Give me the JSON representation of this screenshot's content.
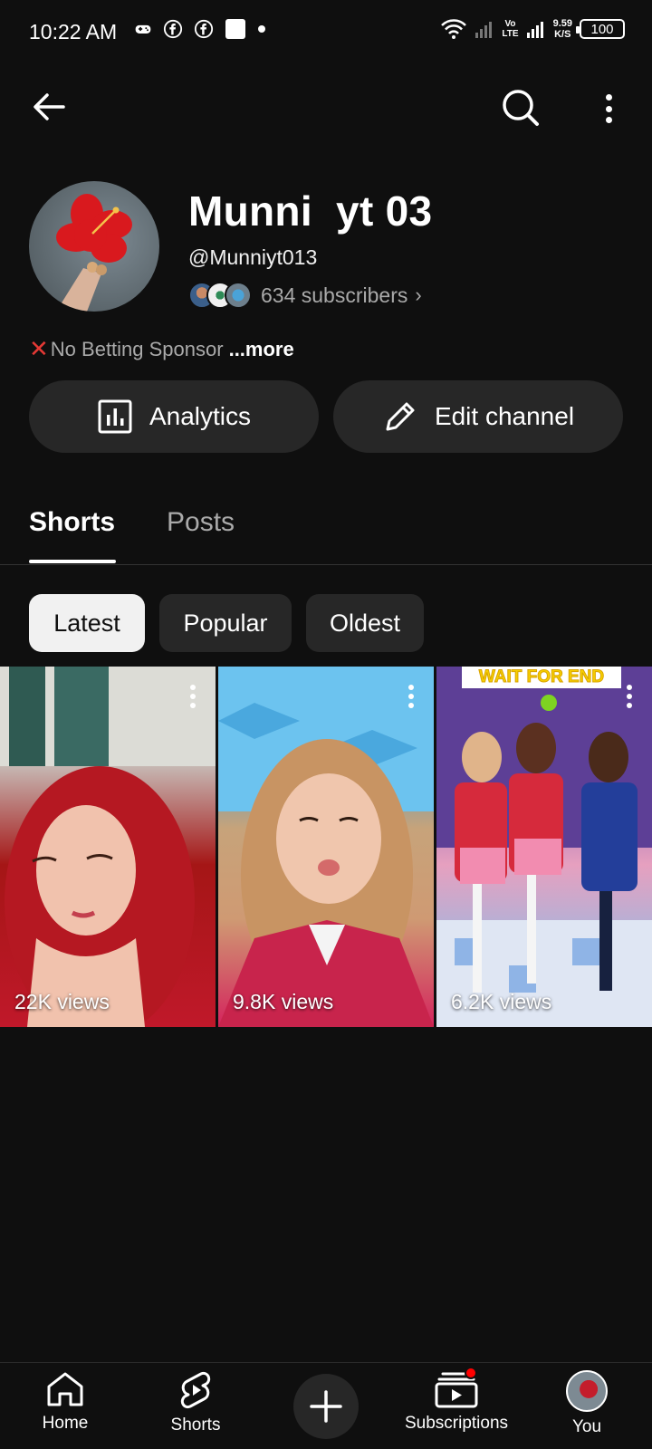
{
  "status_bar": {
    "time": "10:22 AM",
    "net_speed_value": "9.59",
    "net_speed_unit": "K/S",
    "vo_top": "Vo",
    "vo_bottom": "LTE",
    "battery": "100"
  },
  "top_bar": {
    "back_icon": "arrow-left-icon",
    "search_icon": "search-icon",
    "more_icon": "more-vertical-icon"
  },
  "channel": {
    "name": "Munni  yt 03",
    "handle": "@Munniyt013",
    "subscribers": "634 subscribers",
    "description_prefix": "No Betting Sponsor",
    "description_more": "...more"
  },
  "actions": {
    "analytics_label": "Analytics",
    "edit_label": "Edit channel"
  },
  "tabs": [
    {
      "label": "Shorts",
      "selected": true
    },
    {
      "label": "Posts",
      "selected": false
    }
  ],
  "filters": [
    {
      "label": "Latest",
      "selected": true
    },
    {
      "label": "Popular",
      "selected": false
    },
    {
      "label": "Oldest",
      "selected": false
    }
  ],
  "shorts": [
    {
      "views": "22K views"
    },
    {
      "views": "9.8K views"
    },
    {
      "views": "6.2K views",
      "banner": "WAIT FOR END"
    }
  ],
  "bottom_nav": [
    {
      "label": "Home",
      "icon": "home-icon"
    },
    {
      "label": "Shorts",
      "icon": "shorts-icon"
    },
    {
      "label": "",
      "icon": "create-plus-icon"
    },
    {
      "label": "Subscriptions",
      "icon": "subscriptions-icon"
    },
    {
      "label": "You",
      "icon": "profile-avatar"
    }
  ],
  "colors": {
    "background": "#0f0f0f",
    "surface": "#272727",
    "accent_red": "#ff0000",
    "secondary_text": "#aaaaaa"
  }
}
